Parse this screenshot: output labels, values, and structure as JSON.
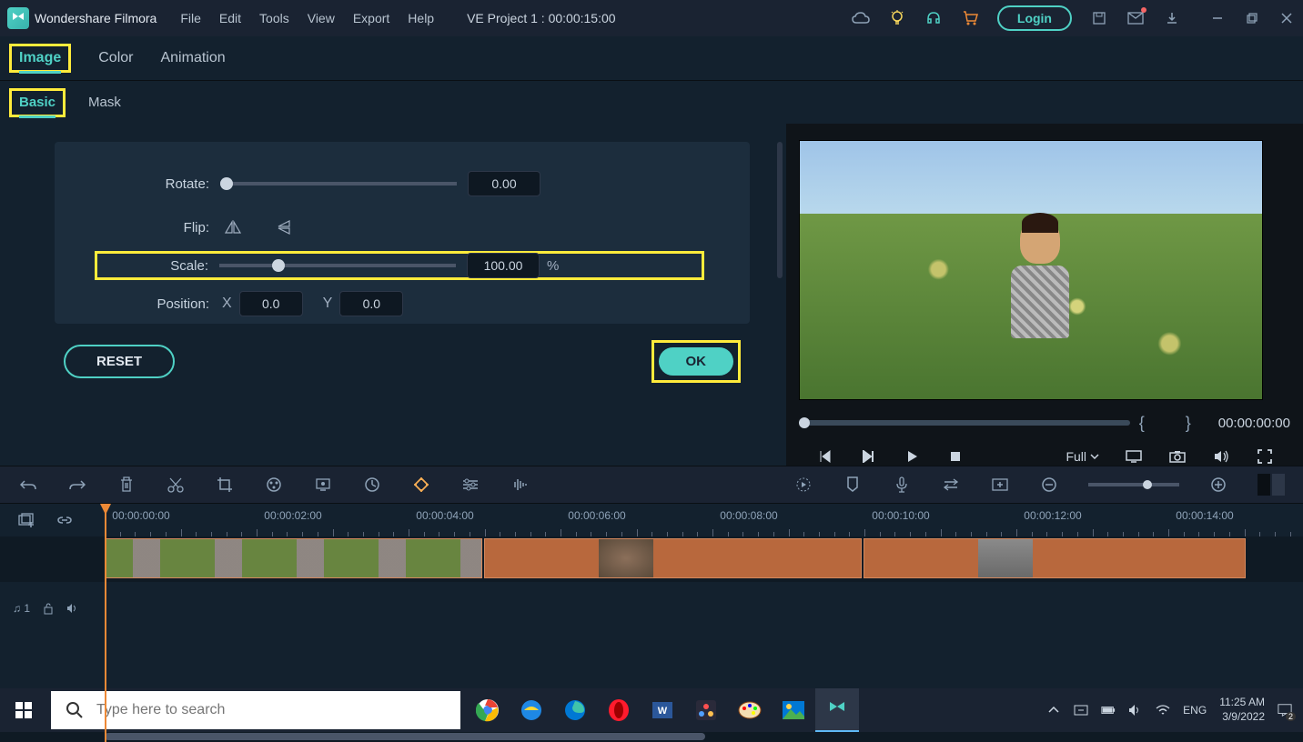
{
  "app": {
    "name": "Wondershare Filmora"
  },
  "menu": {
    "file": "File",
    "edit": "Edit",
    "tools": "Tools",
    "view": "View",
    "export": "Export",
    "help": "Help"
  },
  "project": {
    "label": "VE Project 1 : 00:00:15:00"
  },
  "login": {
    "label": "Login"
  },
  "tabs": {
    "image": "Image",
    "color": "Color",
    "animation": "Animation"
  },
  "subtabs": {
    "basic": "Basic",
    "mask": "Mask"
  },
  "props": {
    "rotate_label": "Rotate:",
    "rotate_value": "0.00",
    "flip_label": "Flip:",
    "scale_label": "Scale:",
    "scale_value": "100.00",
    "scale_unit": "%",
    "position_label": "Position:",
    "x_label": "X",
    "x_value": "0.0",
    "y_label": "Y",
    "y_value": "0.0"
  },
  "buttons": {
    "reset": "RESET",
    "ok": "OK"
  },
  "preview": {
    "quality": "Full",
    "timecode": "00:00:00:00"
  },
  "timeline": {
    "times": [
      "00:00:00:00",
      "00:00:02:00",
      "00:00:04:00",
      "00:00:06:00",
      "00:00:08:00",
      "00:00:10:00",
      "00:00:12:00",
      "00:00:14:00"
    ],
    "audio_track": "♫ 1"
  },
  "taskbar": {
    "search_placeholder": "Type here to search",
    "lang": "ENG",
    "time": "11:25 AM",
    "date": "3/9/2022",
    "badge": "2"
  }
}
